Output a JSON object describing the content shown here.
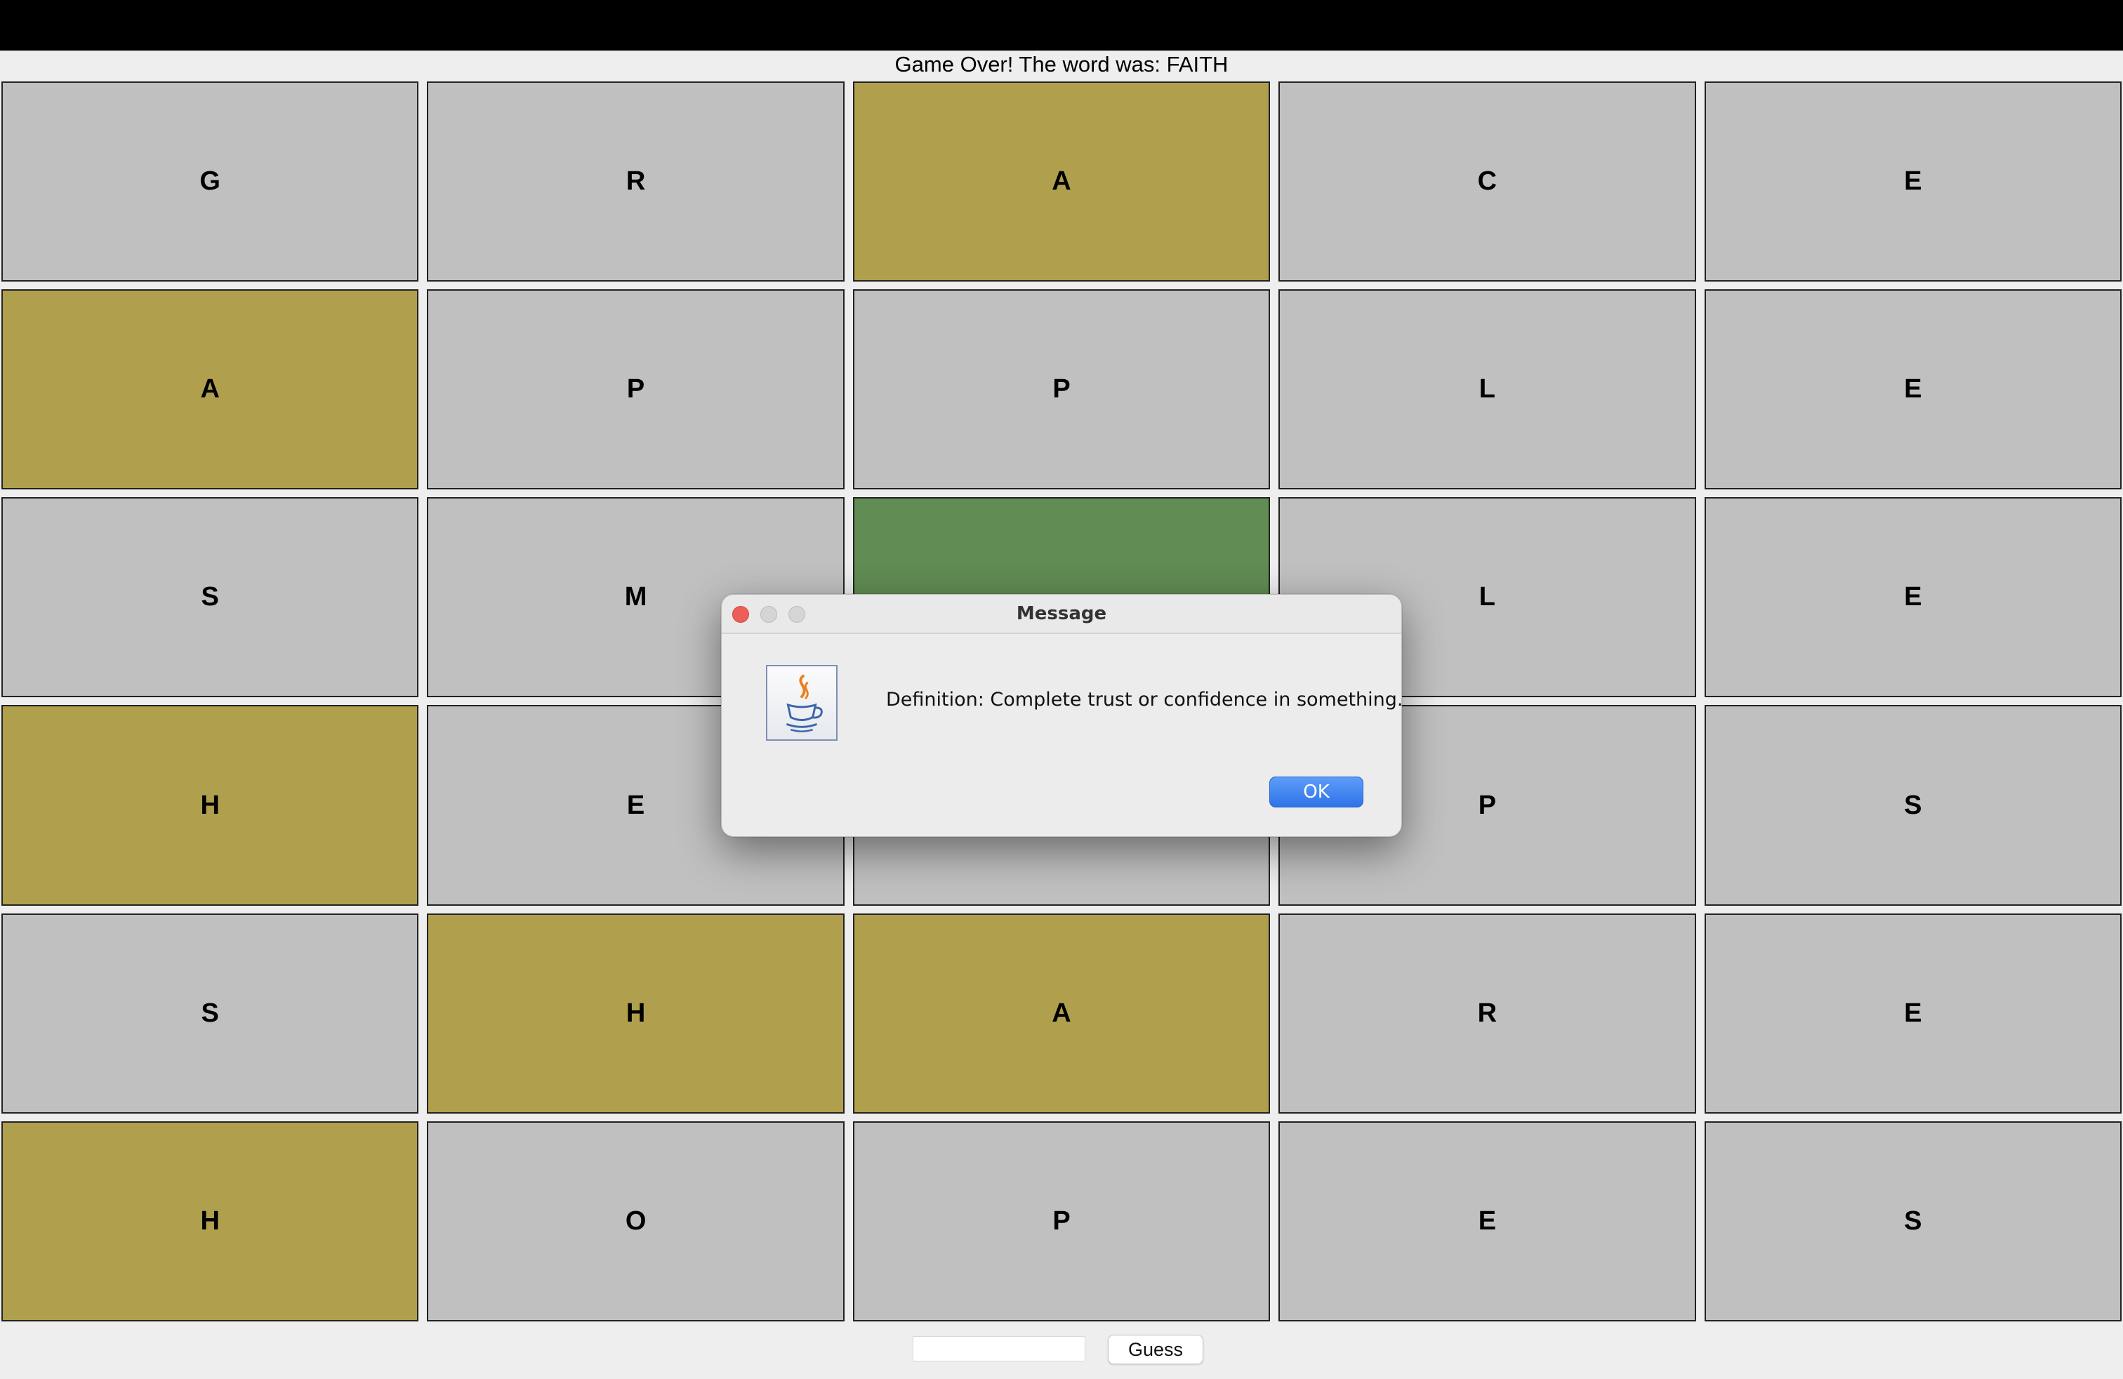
{
  "status": {
    "text": "Game Over! The word was: FAITH"
  },
  "colors": {
    "absent": "#c0c0c0",
    "present": "#b0a04d",
    "correct": "#618c53",
    "ok_button": "#3b7ff0"
  },
  "board": {
    "rows": [
      {
        "letters": [
          {
            "letter": "G",
            "state": "absent"
          },
          {
            "letter": "R",
            "state": "absent"
          },
          {
            "letter": "A",
            "state": "present"
          },
          {
            "letter": "C",
            "state": "absent"
          },
          {
            "letter": "E",
            "state": "absent"
          }
        ]
      },
      {
        "letters": [
          {
            "letter": "A",
            "state": "present"
          },
          {
            "letter": "P",
            "state": "absent"
          },
          {
            "letter": "P",
            "state": "absent"
          },
          {
            "letter": "L",
            "state": "absent"
          },
          {
            "letter": "E",
            "state": "absent"
          }
        ]
      },
      {
        "letters": [
          {
            "letter": "S",
            "state": "absent"
          },
          {
            "letter": "M",
            "state": "absent"
          },
          {
            "letter": "",
            "state": "correct"
          },
          {
            "letter": "L",
            "state": "absent"
          },
          {
            "letter": "E",
            "state": "absent"
          }
        ]
      },
      {
        "letters": [
          {
            "letter": "H",
            "state": "present"
          },
          {
            "letter": "E",
            "state": "absent"
          },
          {
            "letter": "",
            "state": "absent"
          },
          {
            "letter": "P",
            "state": "absent"
          },
          {
            "letter": "S",
            "state": "absent"
          }
        ]
      },
      {
        "letters": [
          {
            "letter": "S",
            "state": "absent"
          },
          {
            "letter": "H",
            "state": "present"
          },
          {
            "letter": "A",
            "state": "present"
          },
          {
            "letter": "R",
            "state": "absent"
          },
          {
            "letter": "E",
            "state": "absent"
          }
        ]
      },
      {
        "letters": [
          {
            "letter": "H",
            "state": "present"
          },
          {
            "letter": "O",
            "state": "absent"
          },
          {
            "letter": "P",
            "state": "absent"
          },
          {
            "letter": "E",
            "state": "absent"
          },
          {
            "letter": "S",
            "state": "absent"
          }
        ]
      }
    ]
  },
  "input": {
    "value": "",
    "placeholder": ""
  },
  "guess_button": {
    "label": "Guess"
  },
  "dialog": {
    "title": "Message",
    "icon": "java-cup-icon",
    "message": "Definition: Complete trust or confidence in something.",
    "ok_label": "OK"
  }
}
